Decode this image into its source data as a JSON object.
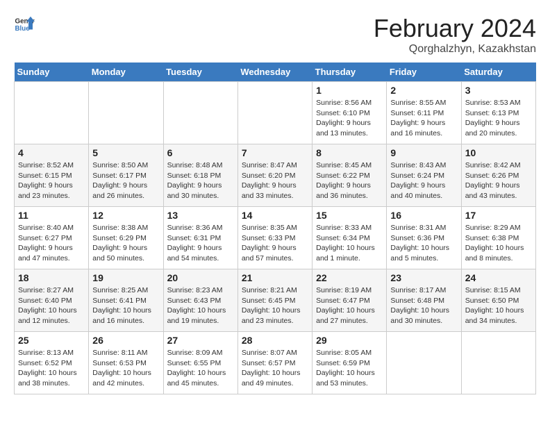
{
  "header": {
    "logo_general": "General",
    "logo_blue": "Blue",
    "month_title": "February 2024",
    "location": "Qorghalzhyn, Kazakhstan"
  },
  "weekdays": [
    "Sunday",
    "Monday",
    "Tuesday",
    "Wednesday",
    "Thursday",
    "Friday",
    "Saturday"
  ],
  "weeks": [
    [
      {
        "day": "",
        "info": ""
      },
      {
        "day": "",
        "info": ""
      },
      {
        "day": "",
        "info": ""
      },
      {
        "day": "",
        "info": ""
      },
      {
        "day": "1",
        "info": "Sunrise: 8:56 AM\nSunset: 6:10 PM\nDaylight: 9 hours\nand 13 minutes."
      },
      {
        "day": "2",
        "info": "Sunrise: 8:55 AM\nSunset: 6:11 PM\nDaylight: 9 hours\nand 16 minutes."
      },
      {
        "day": "3",
        "info": "Sunrise: 8:53 AM\nSunset: 6:13 PM\nDaylight: 9 hours\nand 20 minutes."
      }
    ],
    [
      {
        "day": "4",
        "info": "Sunrise: 8:52 AM\nSunset: 6:15 PM\nDaylight: 9 hours\nand 23 minutes."
      },
      {
        "day": "5",
        "info": "Sunrise: 8:50 AM\nSunset: 6:17 PM\nDaylight: 9 hours\nand 26 minutes."
      },
      {
        "day": "6",
        "info": "Sunrise: 8:48 AM\nSunset: 6:18 PM\nDaylight: 9 hours\nand 30 minutes."
      },
      {
        "day": "7",
        "info": "Sunrise: 8:47 AM\nSunset: 6:20 PM\nDaylight: 9 hours\nand 33 minutes."
      },
      {
        "day": "8",
        "info": "Sunrise: 8:45 AM\nSunset: 6:22 PM\nDaylight: 9 hours\nand 36 minutes."
      },
      {
        "day": "9",
        "info": "Sunrise: 8:43 AM\nSunset: 6:24 PM\nDaylight: 9 hours\nand 40 minutes."
      },
      {
        "day": "10",
        "info": "Sunrise: 8:42 AM\nSunset: 6:26 PM\nDaylight: 9 hours\nand 43 minutes."
      }
    ],
    [
      {
        "day": "11",
        "info": "Sunrise: 8:40 AM\nSunset: 6:27 PM\nDaylight: 9 hours\nand 47 minutes."
      },
      {
        "day": "12",
        "info": "Sunrise: 8:38 AM\nSunset: 6:29 PM\nDaylight: 9 hours\nand 50 minutes."
      },
      {
        "day": "13",
        "info": "Sunrise: 8:36 AM\nSunset: 6:31 PM\nDaylight: 9 hours\nand 54 minutes."
      },
      {
        "day": "14",
        "info": "Sunrise: 8:35 AM\nSunset: 6:33 PM\nDaylight: 9 hours\nand 57 minutes."
      },
      {
        "day": "15",
        "info": "Sunrise: 8:33 AM\nSunset: 6:34 PM\nDaylight: 10 hours\nand 1 minute."
      },
      {
        "day": "16",
        "info": "Sunrise: 8:31 AM\nSunset: 6:36 PM\nDaylight: 10 hours\nand 5 minutes."
      },
      {
        "day": "17",
        "info": "Sunrise: 8:29 AM\nSunset: 6:38 PM\nDaylight: 10 hours\nand 8 minutes."
      }
    ],
    [
      {
        "day": "18",
        "info": "Sunrise: 8:27 AM\nSunset: 6:40 PM\nDaylight: 10 hours\nand 12 minutes."
      },
      {
        "day": "19",
        "info": "Sunrise: 8:25 AM\nSunset: 6:41 PM\nDaylight: 10 hours\nand 16 minutes."
      },
      {
        "day": "20",
        "info": "Sunrise: 8:23 AM\nSunset: 6:43 PM\nDaylight: 10 hours\nand 19 minutes."
      },
      {
        "day": "21",
        "info": "Sunrise: 8:21 AM\nSunset: 6:45 PM\nDaylight: 10 hours\nand 23 minutes."
      },
      {
        "day": "22",
        "info": "Sunrise: 8:19 AM\nSunset: 6:47 PM\nDaylight: 10 hours\nand 27 minutes."
      },
      {
        "day": "23",
        "info": "Sunrise: 8:17 AM\nSunset: 6:48 PM\nDaylight: 10 hours\nand 30 minutes."
      },
      {
        "day": "24",
        "info": "Sunrise: 8:15 AM\nSunset: 6:50 PM\nDaylight: 10 hours\nand 34 minutes."
      }
    ],
    [
      {
        "day": "25",
        "info": "Sunrise: 8:13 AM\nSunset: 6:52 PM\nDaylight: 10 hours\nand 38 minutes."
      },
      {
        "day": "26",
        "info": "Sunrise: 8:11 AM\nSunset: 6:53 PM\nDaylight: 10 hours\nand 42 minutes."
      },
      {
        "day": "27",
        "info": "Sunrise: 8:09 AM\nSunset: 6:55 PM\nDaylight: 10 hours\nand 45 minutes."
      },
      {
        "day": "28",
        "info": "Sunrise: 8:07 AM\nSunset: 6:57 PM\nDaylight: 10 hours\nand 49 minutes."
      },
      {
        "day": "29",
        "info": "Sunrise: 8:05 AM\nSunset: 6:59 PM\nDaylight: 10 hours\nand 53 minutes."
      },
      {
        "day": "",
        "info": ""
      },
      {
        "day": "",
        "info": ""
      }
    ]
  ]
}
